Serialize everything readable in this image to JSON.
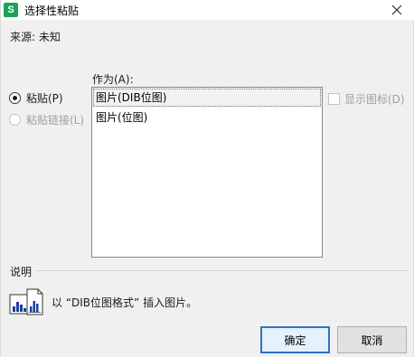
{
  "window": {
    "title": "选择性粘贴",
    "app_icon_letter": "S"
  },
  "source": {
    "label": "来源: 未知"
  },
  "paste_options": [
    {
      "label": "粘贴(P)",
      "checked": true,
      "enabled": true
    },
    {
      "label": "粘贴链接(L)",
      "checked": false,
      "enabled": false
    }
  ],
  "as": {
    "label": "作为(A):",
    "items": [
      {
        "label": "图片(DIB位图)",
        "selected": true
      },
      {
        "label": "图片(位图)",
        "selected": false
      }
    ]
  },
  "display_as_icon": {
    "label": "显示图标(D)",
    "checked": false,
    "enabled": false
  },
  "description": {
    "label": "说明",
    "text": "以 “DIB位图格式” 插入图片。"
  },
  "buttons": {
    "ok": "确定",
    "cancel": "取消"
  },
  "colors": {
    "app_icon": "#1aa35a",
    "default_button_border": "#2f72c4"
  }
}
